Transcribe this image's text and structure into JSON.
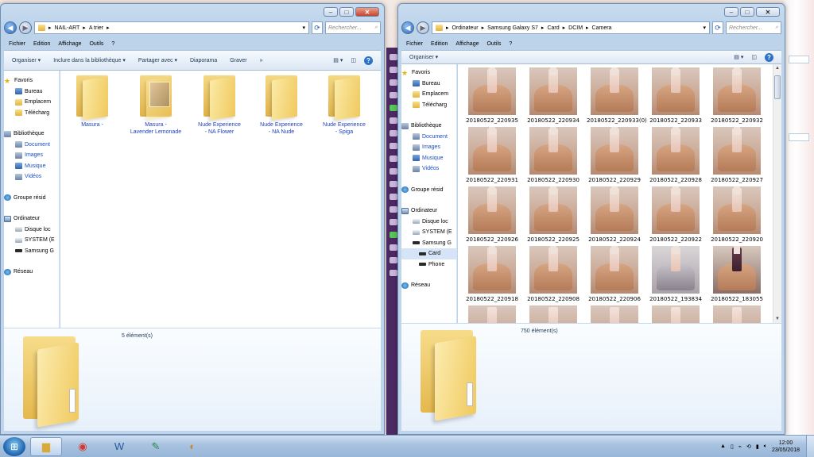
{
  "left_window": {
    "breadcrumb": [
      "NAIL-ART",
      "A trier"
    ],
    "search_placeholder": "Rechercher...",
    "menu": [
      "Fichier",
      "Edition",
      "Affichage",
      "Outils",
      "?"
    ],
    "toolbar": [
      "Organiser",
      "Inclure dans la bibliothèque",
      "Partager avec",
      "Diaporama",
      "Graver",
      "»"
    ],
    "nav": {
      "favorites": "Favoris",
      "fav_items": [
        "Bureau",
        "Emplacem",
        "Télécharg"
      ],
      "libraries": "Bibliothèque",
      "lib_items": [
        "Document",
        "Images",
        "Musique",
        "Vidéos"
      ],
      "homegroup": "Groupe résid",
      "computer": "Ordinateur",
      "computer_items": [
        "Disque loc",
        "SYSTEM (E",
        "Samsung G"
      ],
      "network": "Réseau"
    },
    "folders": [
      {
        "line1": "Masura -",
        "line2": ""
      },
      {
        "line1": "Masura -",
        "line2": "Lavender Lemonade"
      },
      {
        "line1": "Nude Experience",
        "line2": "- NA Flower"
      },
      {
        "line1": "Nude Experience",
        "line2": "- NA Nude"
      },
      {
        "line1": "Nude Experience",
        "line2": "- Spiga"
      }
    ],
    "count": "5 élément(s)"
  },
  "right_window": {
    "breadcrumb": [
      "Ordinateur",
      "Samsung Galaxy S7",
      "Card",
      "DCIM",
      "Camera"
    ],
    "search_placeholder": "Rechercher...",
    "menu": [
      "Fichier",
      "Edition",
      "Affichage",
      "Outils",
      "?"
    ],
    "toolbar": [
      "Organiser"
    ],
    "nav": {
      "favorites": "Favoris",
      "fav_items": [
        "Bureau",
        "Emplacem",
        "Télécharg"
      ],
      "libraries": "Bibliothèque",
      "lib_items": [
        "Document",
        "Images",
        "Musique",
        "Vidéos"
      ],
      "homegroup": "Groupe résid",
      "computer": "Ordinateur",
      "computer_items": [
        "Disque loc",
        "SYSTEM (E",
        "Samsung G"
      ],
      "device_items": [
        "Card",
        "Phone"
      ],
      "network": "Réseau"
    },
    "thumbnails": [
      "20180522_220935",
      "20180522_220934",
      "20180522_220933(0)",
      "20180522_220933",
      "20180522_220932",
      "20180522_220931",
      "20180522_220930",
      "20180522_220929",
      "20180522_220928",
      "20180522_220927",
      "20180522_220926",
      "20180522_220925",
      "20180522_220924",
      "20180522_220922",
      "20180522_220920",
      "20180522_220918",
      "20180522_220908",
      "20180522_220906",
      "20180522_193834",
      "20180522_183055"
    ],
    "count": "750 élément(s)"
  },
  "taskbar": {
    "time": "12:00",
    "date": "23/05/2018"
  }
}
